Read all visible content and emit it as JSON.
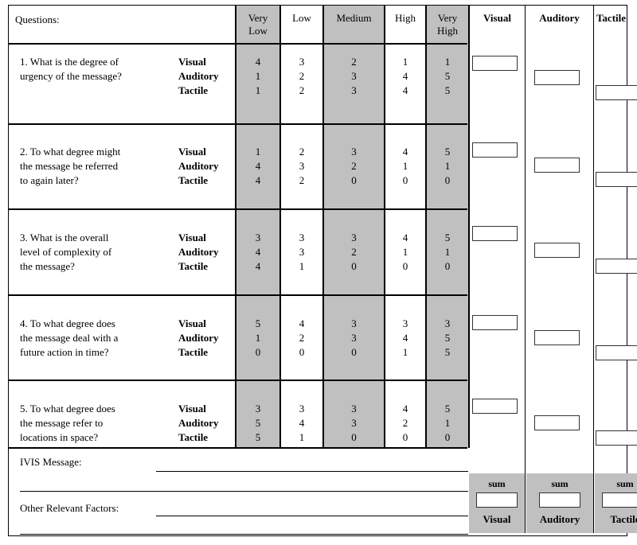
{
  "form": {
    "questions_header": "Questions:",
    "scale_headers": [
      "Very\nLow",
      "Low",
      "Medium",
      "High",
      "Very\nHigh"
    ],
    "modality_headers": [
      "Visual",
      "Auditory",
      "Tactile"
    ],
    "modality_labels": "Visual\nAuditory\nTactile",
    "questions": [
      {
        "number": "1.",
        "text": "1.  What is the degree of\nurgency of the message?",
        "ratings": {
          "Visual": [
            4,
            3,
            2,
            1,
            1
          ],
          "Auditory": [
            1,
            2,
            3,
            4,
            5
          ],
          "Tactile": [
            1,
            2,
            3,
            4,
            5
          ]
        }
      },
      {
        "number": "2.",
        "text": "2.  To what degree might\nthe message be referred\nto again later?",
        "ratings": {
          "Visual": [
            1,
            2,
            3,
            4,
            5
          ],
          "Auditory": [
            4,
            3,
            2,
            1,
            1
          ],
          "Tactile": [
            4,
            2,
            0,
            0,
            0
          ]
        }
      },
      {
        "number": "3.",
        "text": "3.  What is the overall\nlevel of complexity of\nthe message?",
        "ratings": {
          "Visual": [
            3,
            3,
            3,
            4,
            5
          ],
          "Auditory": [
            4,
            3,
            2,
            1,
            1
          ],
          "Tactile": [
            4,
            1,
            0,
            0,
            0
          ]
        }
      },
      {
        "number": "4.",
        "text": "4.  To what degree does\nthe message deal with a\nfuture action in time?",
        "ratings": {
          "Visual": [
            5,
            4,
            3,
            3,
            3
          ],
          "Auditory": [
            1,
            2,
            3,
            4,
            5
          ],
          "Tactile": [
            0,
            0,
            0,
            1,
            5
          ]
        }
      },
      {
        "number": "5.",
        "text": "5.  To what degree does\nthe message refer to\nlocations in space?",
        "ratings": {
          "Visual": [
            3,
            3,
            3,
            4,
            5
          ],
          "Auditory": [
            5,
            4,
            3,
            2,
            1
          ],
          "Tactile": [
            5,
            1,
            0,
            0,
            0
          ]
        }
      }
    ],
    "free_text": {
      "ivis_label": "IVIS Message:",
      "ivis_value": "",
      "ivis_placeholder": "",
      "other_label": "Other Relevant Factors:",
      "other_value": "",
      "other_placeholder": ""
    },
    "totals": {
      "sum_label": "sum",
      "columns": [
        {
          "name": "Visual",
          "value": ""
        },
        {
          "name": "Auditory",
          "value": ""
        },
        {
          "name": "Tactile",
          "value": ""
        }
      ]
    }
  },
  "colors": {
    "shade": "#c0c0c0",
    "rule": "#000000",
    "box_border": "#333333"
  }
}
